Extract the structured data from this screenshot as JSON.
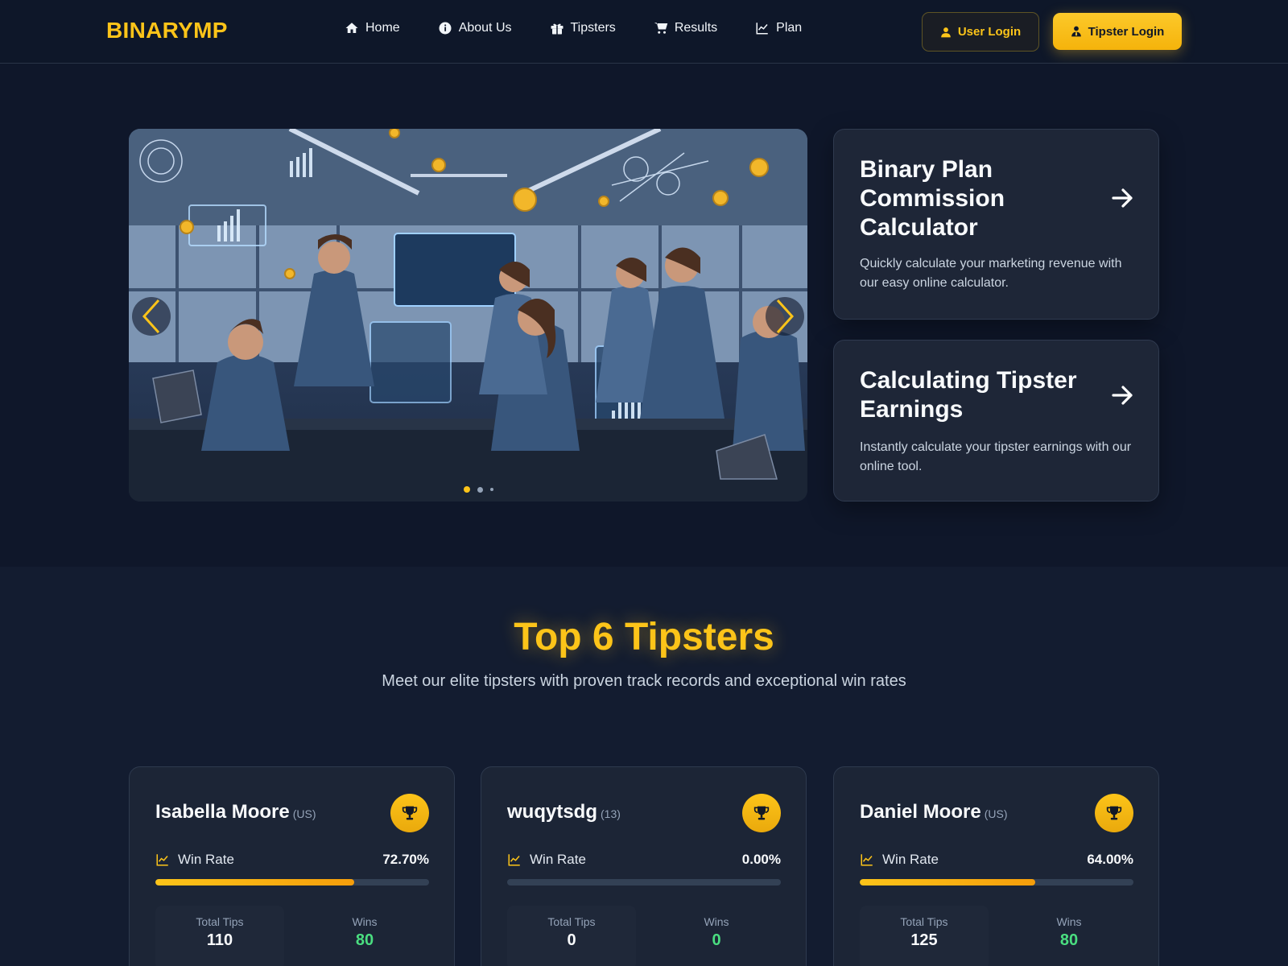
{
  "brand": {
    "name": "BINARYMP",
    "accent": "#fcc419",
    "background": "#0f172a"
  },
  "nav": {
    "items": [
      {
        "label": "Home",
        "icon": "home-icon"
      },
      {
        "label": "About Us",
        "icon": "info-icon"
      },
      {
        "label": "Tipsters",
        "icon": "gift-icon"
      },
      {
        "label": "Results",
        "icon": "cart-icon"
      },
      {
        "label": "Plan",
        "icon": "chart-line-icon"
      }
    ],
    "user_login": "User Login",
    "tipster_login": "Tipster Login"
  },
  "hero": {
    "carousel": {
      "slides": 3,
      "active_slide": 1,
      "image": "team-analytics-office-illustration"
    },
    "promos": [
      {
        "title": "Binary Plan Commission Calculator",
        "description": "Quickly calculate your marketing revenue with our easy online calculator."
      },
      {
        "title": "Calculating Tipster Earnings",
        "description": "Instantly calculate your tipster earnings with our online tool."
      }
    ]
  },
  "tipsters": {
    "title": "Top 6 Tipsters",
    "subtitle": "Meet our elite tipsters with proven track records and exceptional win rates",
    "win_rate_label": "Win Rate",
    "total_tips_label": "Total Tips",
    "wins_label": "Wins",
    "cards": [
      {
        "name": "Isabella Moore",
        "country": "(US)",
        "win_rate": "72.70%",
        "win_rate_pct": 72.7,
        "total_tips": "110",
        "wins": "80"
      },
      {
        "name": "wuqytsdg",
        "country": "(13)",
        "win_rate": "0.00%",
        "win_rate_pct": 0,
        "total_tips": "0",
        "wins": "0"
      },
      {
        "name": "Daniel Moore",
        "country": "(US)",
        "win_rate": "64.00%",
        "win_rate_pct": 64,
        "total_tips": "125",
        "wins": "80"
      }
    ]
  }
}
